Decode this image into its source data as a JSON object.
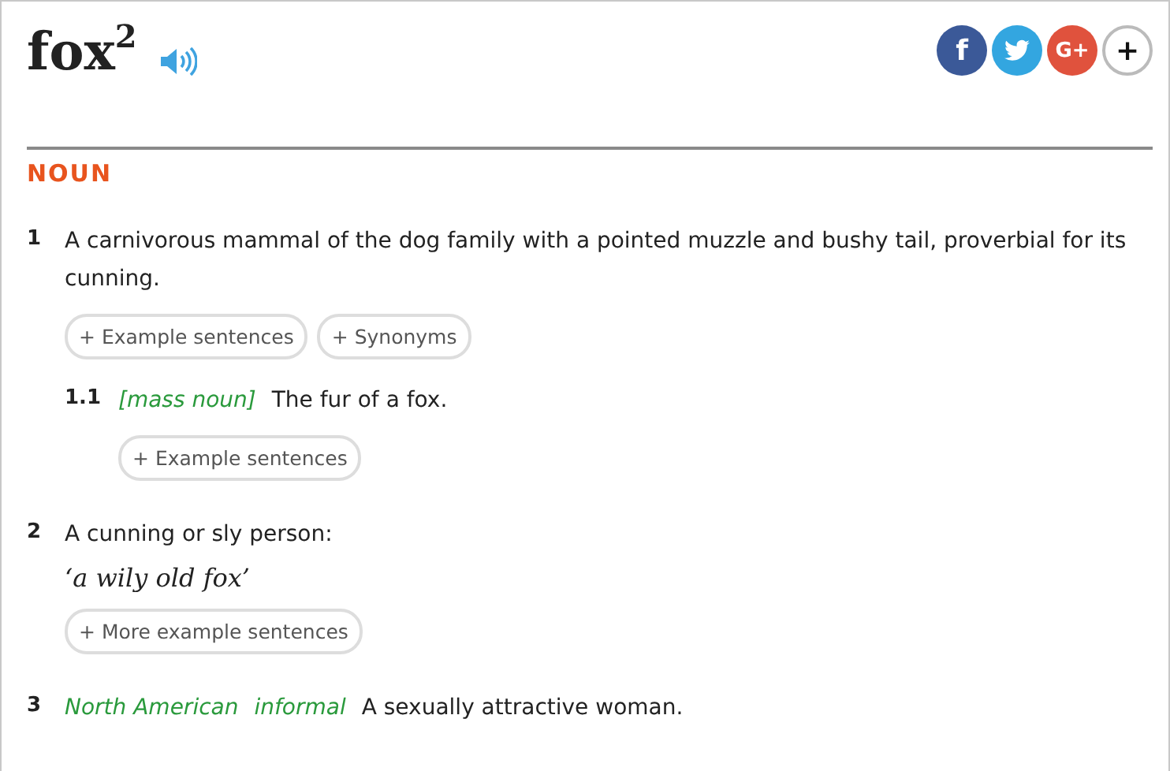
{
  "entry": {
    "headword": "fox",
    "homograph": "2"
  },
  "share": [
    {
      "kind": "facebook",
      "text": "f"
    },
    {
      "kind": "twitter"
    },
    {
      "kind": "google",
      "text": "G+"
    },
    {
      "kind": "more",
      "text": "+"
    }
  ],
  "part_of_speech": "NOUN",
  "senses": [
    {
      "number": "1",
      "definition": "A carnivorous mammal of the dog family with a pointed muzzle and bushy tail, proverbial for its cunning.",
      "buttons": [
        "+ Example sentences",
        "+ Synonyms"
      ],
      "children": [
        {
          "number": "1.1",
          "labels": [
            "[mass noun]"
          ],
          "definition": "The fur of a fox.",
          "buttons": [
            "+ Example sentences"
          ]
        }
      ]
    },
    {
      "number": "2",
      "definition": "A cunning or sly person:",
      "example": "‘a wily old fox’",
      "buttons": [
        "+ More example sentences"
      ]
    },
    {
      "number": "3",
      "labels": [
        "North American",
        "informal"
      ],
      "definition": "A sexually attractive woman."
    }
  ]
}
